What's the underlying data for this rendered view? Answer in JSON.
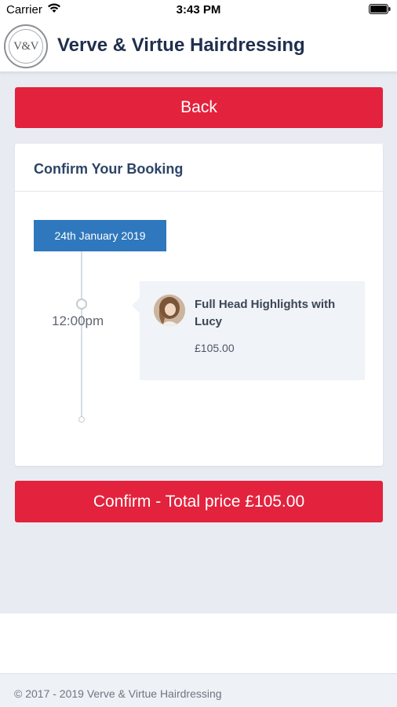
{
  "status_bar": {
    "carrier": "Carrier",
    "time": "3:43 PM",
    "wifi_icon": "wifi-icon",
    "battery_icon": "battery-icon"
  },
  "header": {
    "logo_text": "V&V",
    "title": "Verve & Virtue Hairdressing"
  },
  "back_button": {
    "label": "Back"
  },
  "booking": {
    "title": "Confirm Your Booking",
    "date": "24th January 2019",
    "appointments": [
      {
        "time": "12:00pm",
        "service": "Full Head Highlights with Lucy",
        "price": "£105.00",
        "avatar_icon": "stylist-avatar"
      }
    ]
  },
  "confirm_button": {
    "label": "Confirm - Total price £105.00"
  },
  "footer": {
    "copyright": "© 2017 - 2019 Verve & Virtue Hairdressing"
  },
  "colors": {
    "accent_red": "#e3223d",
    "date_blue": "#2f78bd",
    "title_navy": "#1f2f4d",
    "page_bg": "#e8ecf2"
  }
}
